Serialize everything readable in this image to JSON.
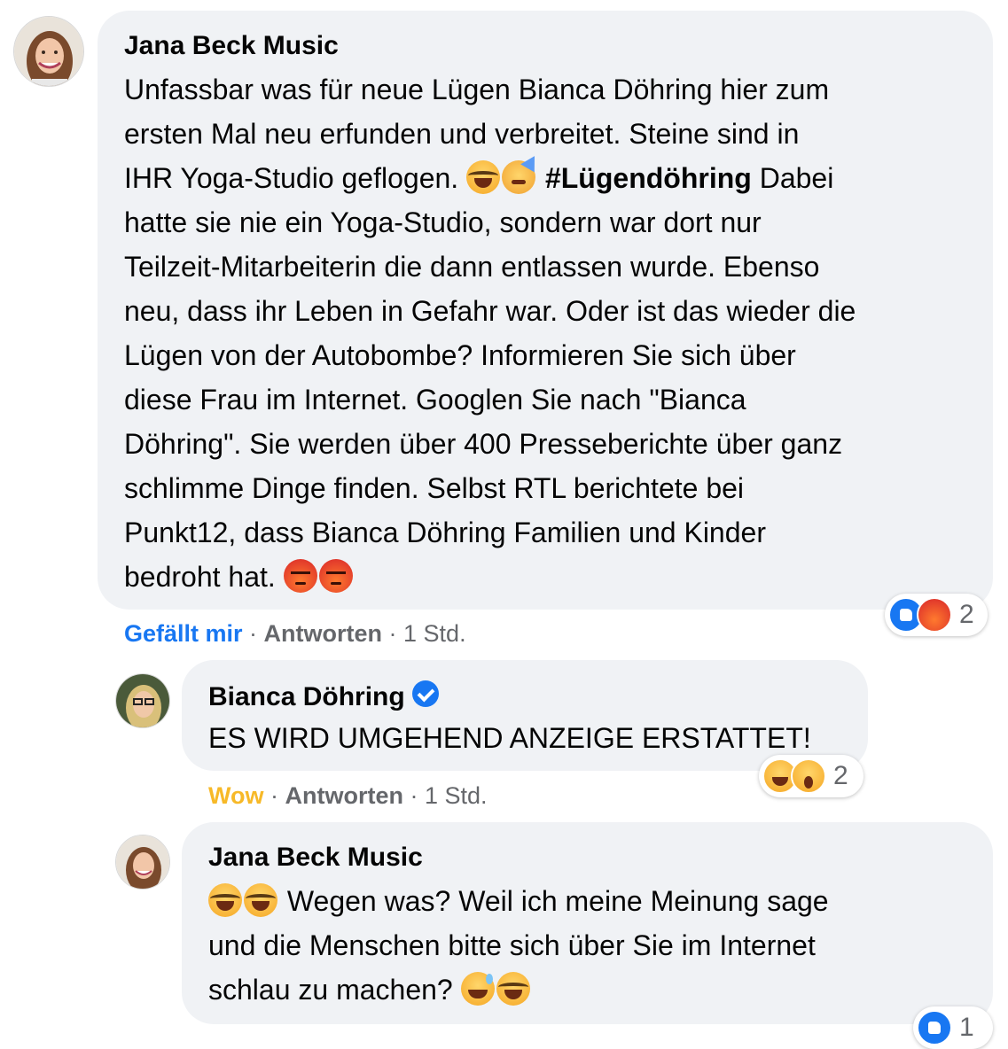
{
  "comments": [
    {
      "author": "Jana Beck Music",
      "text_part1": "Unfassbar was für neue Lügen Bianca Döhring hier zum\nersten Mal neu erfunden und verbreitet. Steine sind in\nIHR Yoga-Studio geflogen. ",
      "hashtag": "#Lügendöhring",
      "text_part2": " Dabei\nhatte sie nie ein Yoga-Studio, sondern war dort nur\nTeilzeit-Mitarbeiterin die dann entlassen wurde. Ebenso\nneu, dass ihr Leben in Gefahr war. Oder ist das wieder die\nLügen von der Autobombe? Informieren Sie sich über\ndiese Frau im Internet. Googlen Sie nach \"Bianca\nDöhring\". Sie werden über 400 Presseberichte über ganz\nschlimme Dinge finden. Selbst RTL berichtete bei\nPunkt12, dass Bianca Döhring Familien und Kinder\nbedroht hat. ",
      "emojis": [
        "tears-of-joy",
        "partying-face",
        "angry-face",
        "angry-face"
      ],
      "action_reaction": "Gefällt mir",
      "action_reply": "Antworten",
      "time": "1 Std.",
      "reaction_icons": [
        "like",
        "angry"
      ],
      "reaction_count": "2"
    },
    {
      "author": "Bianca Döhring",
      "verified": true,
      "text": "ES WIRD UMGEHEND ANZEIGE ERSTATTET!",
      "action_reaction": "Wow",
      "action_reply": "Antworten",
      "time": "1 Std.",
      "reaction_icons": [
        "haha",
        "wow"
      ],
      "reaction_count": "2"
    },
    {
      "author": "Jana Beck Music",
      "text_part1": " Wegen was? Weil ich meine Meinung sage\nund die Menschen bitte sich über Sie im Internet\nschlau zu machen? ",
      "emojis": [
        "tears-of-joy",
        "rolling-laughing",
        "grinning-sweat",
        "tears-of-joy"
      ],
      "reaction_icons": [
        "like"
      ],
      "reaction_count": "1"
    }
  ],
  "separator": " · ",
  "colors": {
    "bubble": "#f0f2f5",
    "like_blue": "#1877f2",
    "wow_yellow": "#f7b928",
    "secondary": "#65676b"
  }
}
